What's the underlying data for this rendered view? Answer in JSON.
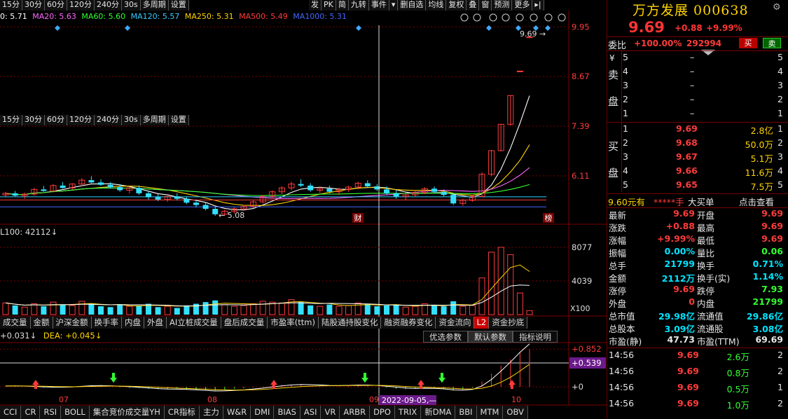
{
  "toolbar": {
    "periods": [
      "15分",
      "30分",
      "60分",
      "120分",
      "240分",
      "30s",
      "多周期",
      "设置"
    ],
    "periods2": [
      "15分",
      "30分",
      "60分",
      "120分",
      "240分",
      "30s",
      "多周期",
      "设置"
    ],
    "actions": [
      "发",
      "PK",
      "简",
      "九转",
      "事件",
      "▾",
      "删自选",
      "均线",
      "复权",
      "叠",
      "窗",
      "预测",
      "更多",
      "▸|"
    ]
  },
  "ma_legend": [
    {
      "label": "0: 5.71",
      "color": "#ffffff"
    },
    {
      "label": "MA20: 5.63",
      "color": "#ff66ff"
    },
    {
      "label": "MA60: 5.60",
      "color": "#33ff33"
    },
    {
      "label": "MA120: 5.57",
      "color": "#33ccff"
    },
    {
      "label": "MA250: 5.31",
      "color": "#ffd400"
    },
    {
      "label": "MA500: 5.49",
      "color": "#ff3b3b"
    },
    {
      "label": "MA1000: 5.31",
      "color": "#4466ff"
    }
  ],
  "price_axis": [
    "9.95",
    "8.67",
    "7.39",
    "6.11"
  ],
  "annotations": {
    "high_label": "9.69 →",
    "low_label": "← 5.08",
    "cai_marker": "财",
    "bang_marker": "榜"
  },
  "volume": {
    "legend": "L100: 42112↓",
    "axis": [
      "8077",
      "4039"
    ],
    "unit": "X100"
  },
  "macd": {
    "legend_dif": "+0.031↓",
    "legend_dea": "DEA: +0.045↓",
    "axis": [
      "+0.852",
      "+0.539",
      "+0"
    ],
    "highlight_value": "+0.539",
    "date_cursor": "2022-09-05,—"
  },
  "x_labels": [
    "07",
    "08",
    "09",
    "10"
  ],
  "indicator_tabs": [
    "成交量",
    "金额",
    "沪深金额",
    "换手率",
    "内盘",
    "外盘",
    "AI立桩成交量",
    "盘后成交量",
    "市盈率(ttm)",
    "陆股通持股变化",
    "融资融券变化",
    "资金流向",
    "L2",
    "资金抄底"
  ],
  "param_buttons": [
    "优选参数",
    "默认参数",
    "指标说明"
  ],
  "bottom_tabs": [
    "CCI",
    "CR",
    "RSI",
    "BOLL",
    "集合竞价成交量YH",
    "CR指标",
    "主力",
    "W&R",
    "DMI",
    "BIAS",
    "ASI",
    "VR",
    "ARBR",
    "DPO",
    "TRIX",
    "新DMA",
    "BBI",
    "MTM",
    "OBV"
  ],
  "quote": {
    "title": "万方发展 000638",
    "price": "9.69",
    "change": "+0.88",
    "change_pct": "+9.99%",
    "weibi_label": "委比",
    "weibi_value": "+100.00%",
    "weicha_value": "292994",
    "buy_btn": "买",
    "sell_btn": "卖",
    "sell_side_label": [
      "¥",
      "卖",
      "盘"
    ],
    "buy_side_label": [
      "买",
      "盘"
    ],
    "sell_levels": [
      {
        "lvl": "5",
        "price": "–",
        "vol": "",
        "cnt": "5"
      },
      {
        "lvl": "4",
        "price": "–",
        "vol": "",
        "cnt": "4"
      },
      {
        "lvl": "3",
        "price": "–",
        "vol": "",
        "cnt": "3"
      },
      {
        "lvl": "2",
        "price": "–",
        "vol": "",
        "cnt": "2"
      },
      {
        "lvl": "1",
        "price": "–",
        "vol": "",
        "cnt": "1"
      }
    ],
    "buy_levels": [
      {
        "lvl": "1",
        "price": "9.69",
        "vol": "2.8亿",
        "cnt": "1"
      },
      {
        "lvl": "2",
        "price": "9.68",
        "vol": "50.0万",
        "cnt": "2"
      },
      {
        "lvl": "3",
        "price": "9.67",
        "vol": "5.1万",
        "cnt": "3"
      },
      {
        "lvl": "4",
        "price": "9.66",
        "vol": "11.6万",
        "cnt": "4"
      },
      {
        "lvl": "5",
        "price": "9.65",
        "vol": "7.5万",
        "cnt": "5"
      }
    ],
    "bigorder": {
      "left": "9.60元有",
      "stars": "*****手",
      "mid": "大买单",
      "right": "点击查看"
    },
    "stats": [
      {
        "l1": "最新",
        "v1": "9.69",
        "c1": "red",
        "l2": "开盘",
        "v2": "9.69",
        "c2": "red"
      },
      {
        "l1": "涨跌",
        "v1": "+0.88",
        "c1": "red",
        "l2": "最高",
        "v2": "9.69",
        "c2": "red"
      },
      {
        "l1": "涨幅",
        "v1": "+9.99%",
        "c1": "red",
        "l2": "最低",
        "v2": "9.69",
        "c2": "red"
      },
      {
        "l1": "振幅",
        "v1": "0.00%",
        "c1": "cyan",
        "l2": "量比",
        "v2": "0.06",
        "c2": "green"
      },
      {
        "l1": "总手",
        "v1": "21799",
        "c1": "cyan",
        "l2": "换手",
        "v2": "0.71%",
        "c2": "cyan"
      },
      {
        "l1": "金额",
        "v1": "2112万",
        "c1": "cyan",
        "l2": "换手(实)",
        "v2": "1.14%",
        "c2": "cyan"
      },
      {
        "l1": "涨停",
        "v1": "9.69",
        "c1": "red",
        "l2": "跌停",
        "v2": "7.93",
        "c2": "green"
      },
      {
        "l1": "外盘",
        "v1": "0",
        "c1": "red",
        "l2": "内盘",
        "v2": "21799",
        "c2": "green"
      },
      {
        "l1": "总市值",
        "v1": "29.98亿",
        "c1": "cyan",
        "l2": "流通值",
        "v2": "29.86亿",
        "c2": "cyan"
      },
      {
        "l1": "总股本",
        "v1": "3.09亿",
        "c1": "cyan",
        "l2": "流通股",
        "v2": "3.08亿",
        "c2": "cyan"
      },
      {
        "l1": "市盈(静)",
        "v1": "47.73",
        "c1": "white",
        "l2": "市盈(TTM)",
        "v2": "69.69",
        "c2": "white"
      }
    ],
    "ticks": [
      {
        "time": "14:56",
        "price": "9.69",
        "vol": "2.6万",
        "n": "2"
      },
      {
        "time": "14:56",
        "price": "9.69",
        "vol": "0.8万",
        "n": "2"
      },
      {
        "time": "14:56",
        "price": "9.69",
        "vol": "0.5万",
        "n": "1"
      },
      {
        "time": "14:56",
        "price": "9.69",
        "vol": "1.0万",
        "n": "2"
      }
    ]
  },
  "colors": {
    "up": "#ff3b3b",
    "down": "#33e0ff",
    "bg": "#000000",
    "grid": "#7a0000"
  },
  "chart_data": {
    "type": "candlestick",
    "price_range": [
      4.9,
      10.1
    ],
    "volume_range": [
      0,
      9000
    ],
    "macd_range": [
      -0.25,
      0.95
    ],
    "candles": [
      [
        5.62,
        5.7,
        5.55,
        5.66
      ],
      [
        5.66,
        5.72,
        5.58,
        5.6
      ],
      [
        5.6,
        5.68,
        5.52,
        5.64
      ],
      [
        5.64,
        5.8,
        5.6,
        5.76
      ],
      [
        5.76,
        5.85,
        5.7,
        5.72
      ],
      [
        5.72,
        5.9,
        5.68,
        5.86
      ],
      [
        5.86,
        5.95,
        5.78,
        5.8
      ],
      [
        5.8,
        5.92,
        5.76,
        5.9
      ],
      [
        5.9,
        6.05,
        5.85,
        6.0
      ],
      [
        6.0,
        6.1,
        5.92,
        5.94
      ],
      [
        5.94,
        6.02,
        5.85,
        5.88
      ],
      [
        5.88,
        5.95,
        5.78,
        5.82
      ],
      [
        5.82,
        5.9,
        5.7,
        5.74
      ],
      [
        5.74,
        5.84,
        5.66,
        5.8
      ],
      [
        5.8,
        5.86,
        5.62,
        5.66
      ],
      [
        5.66,
        5.72,
        5.5,
        5.56
      ],
      [
        5.56,
        5.64,
        5.46,
        5.5
      ],
      [
        5.5,
        5.62,
        5.44,
        5.58
      ],
      [
        5.58,
        5.66,
        5.48,
        5.52
      ],
      [
        5.52,
        5.58,
        5.38,
        5.42
      ],
      [
        5.42,
        5.5,
        5.3,
        5.36
      ],
      [
        5.36,
        5.44,
        5.22,
        5.26
      ],
      [
        5.26,
        5.32,
        5.08,
        5.12
      ],
      [
        5.12,
        5.24,
        5.08,
        5.2
      ],
      [
        5.2,
        5.3,
        5.14,
        5.26
      ],
      [
        5.26,
        5.36,
        5.2,
        5.32
      ],
      [
        5.32,
        5.48,
        5.28,
        5.44
      ],
      [
        5.44,
        5.62,
        5.4,
        5.58
      ],
      [
        5.58,
        5.74,
        5.52,
        5.7
      ],
      [
        5.7,
        5.84,
        5.64,
        5.8
      ],
      [
        5.8,
        5.96,
        5.74,
        5.9
      ],
      [
        5.9,
        6.02,
        5.82,
        5.86
      ],
      [
        5.86,
        5.92,
        5.7,
        5.74
      ],
      [
        5.74,
        5.84,
        5.66,
        5.78
      ],
      [
        5.78,
        5.86,
        5.66,
        5.7
      ],
      [
        5.7,
        5.8,
        5.62,
        5.76
      ],
      [
        5.76,
        5.86,
        5.7,
        5.82
      ],
      [
        5.82,
        5.96,
        5.76,
        5.92
      ],
      [
        5.92,
        6.0,
        5.8,
        5.84
      ],
      [
        5.84,
        5.9,
        5.72,
        5.76
      ],
      [
        5.76,
        5.84,
        5.62,
        5.66
      ],
      [
        5.66,
        5.74,
        5.52,
        5.58
      ],
      [
        5.58,
        5.66,
        5.48,
        5.62
      ],
      [
        5.62,
        5.72,
        5.56,
        5.68
      ],
      [
        5.68,
        5.82,
        5.64,
        5.78
      ],
      [
        5.78,
        5.84,
        5.66,
        5.7
      ],
      [
        5.7,
        5.76,
        5.58,
        5.62
      ],
      [
        5.62,
        5.66,
        5.36,
        5.4
      ],
      [
        5.4,
        5.52,
        5.34,
        5.48
      ],
      [
        5.48,
        5.62,
        5.44,
        5.58
      ],
      [
        5.58,
        6.2,
        5.56,
        6.15
      ],
      [
        6.15,
        6.78,
        6.1,
        6.76
      ],
      [
        6.76,
        7.44,
        6.74,
        7.44
      ],
      [
        7.44,
        8.18,
        7.4,
        8.18
      ],
      [
        8.81,
        8.81,
        8.81,
        8.81
      ],
      [
        9.69,
        9.69,
        9.69,
        9.69
      ]
    ],
    "volumes": [
      1400,
      1100,
      900,
      1300,
      1000,
      1500,
      1200,
      1100,
      1600,
      1300,
      1000,
      900,
      1200,
      1000,
      1100,
      1300,
      900,
      1000,
      800,
      1100,
      1300,
      1500,
      1700,
      1200,
      1000,
      1100,
      1300,
      1600,
      1500,
      1400,
      1800,
      1500,
      1100,
      1000,
      1200,
      1000,
      1100,
      1400,
      1300,
      1000,
      1100,
      1200,
      900,
      1000,
      1300,
      1100,
      1000,
      1600,
      1000,
      1100,
      4400,
      7500,
      8077,
      7200,
      2600,
      480
    ],
    "macd_bars": [
      0.02,
      0.01,
      0.0,
      -0.01,
      -0.02,
      -0.02,
      -0.01,
      0.0,
      0.02,
      0.03,
      0.02,
      0.0,
      -0.01,
      -0.02,
      -0.03,
      -0.04,
      -0.05,
      -0.05,
      -0.04,
      -0.05,
      -0.06,
      -0.07,
      -0.08,
      -0.06,
      -0.04,
      -0.03,
      -0.01,
      0.01,
      0.03,
      0.04,
      0.05,
      0.04,
      0.02,
      0.01,
      0.0,
      0.01,
      0.02,
      0.03,
      0.02,
      0.0,
      -0.02,
      -0.04,
      -0.05,
      -0.04,
      -0.02,
      -0.03,
      -0.05,
      -0.08,
      -0.06,
      -0.02,
      0.12,
      0.3,
      0.48,
      0.62,
      0.78,
      0.85
    ]
  }
}
